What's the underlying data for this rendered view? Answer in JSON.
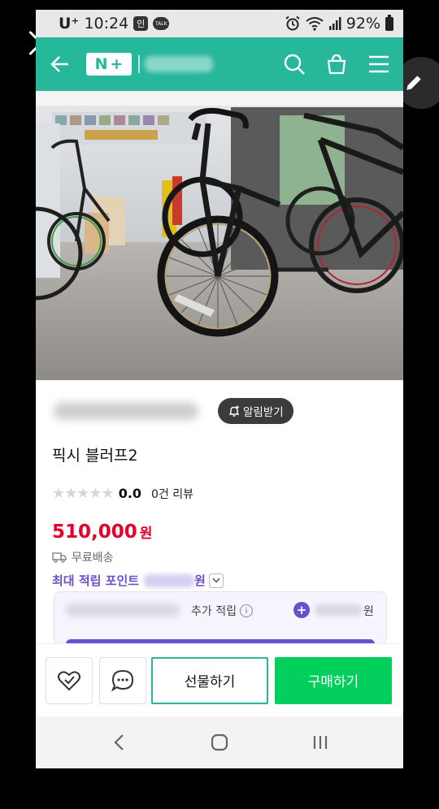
{
  "status_bar": {
    "carrier": "U⁺",
    "time": "10:24",
    "badge_label": "인",
    "talk_label": "TALK",
    "battery": "92%"
  },
  "header": {
    "logo_n": "N",
    "logo_plus": "+",
    "icons": [
      "back-arrow-icon",
      "search-icon",
      "shopping-bag-icon",
      "menu-icon"
    ]
  },
  "product": {
    "alarm_label": "알림받기",
    "title": "픽시 블러프2",
    "rating": "0.0",
    "review_count": "0건 리뷰",
    "price": "510,000",
    "price_unit": "원",
    "shipping": "무료배송",
    "points_label": "최대 적립 포인트",
    "points_unit": "원"
  },
  "points_card": {
    "label": "추가 적립",
    "info_glyph": "i",
    "plus_glyph": "+",
    "unit": "원"
  },
  "actions": {
    "gift_label": "선물하기",
    "buy_label": "구매하기"
  },
  "colors": {
    "brand_green": "#27b79b",
    "price_red": "#e4002b",
    "points_purple": "#6b4fd1",
    "buy_green": "#03cf5d"
  }
}
